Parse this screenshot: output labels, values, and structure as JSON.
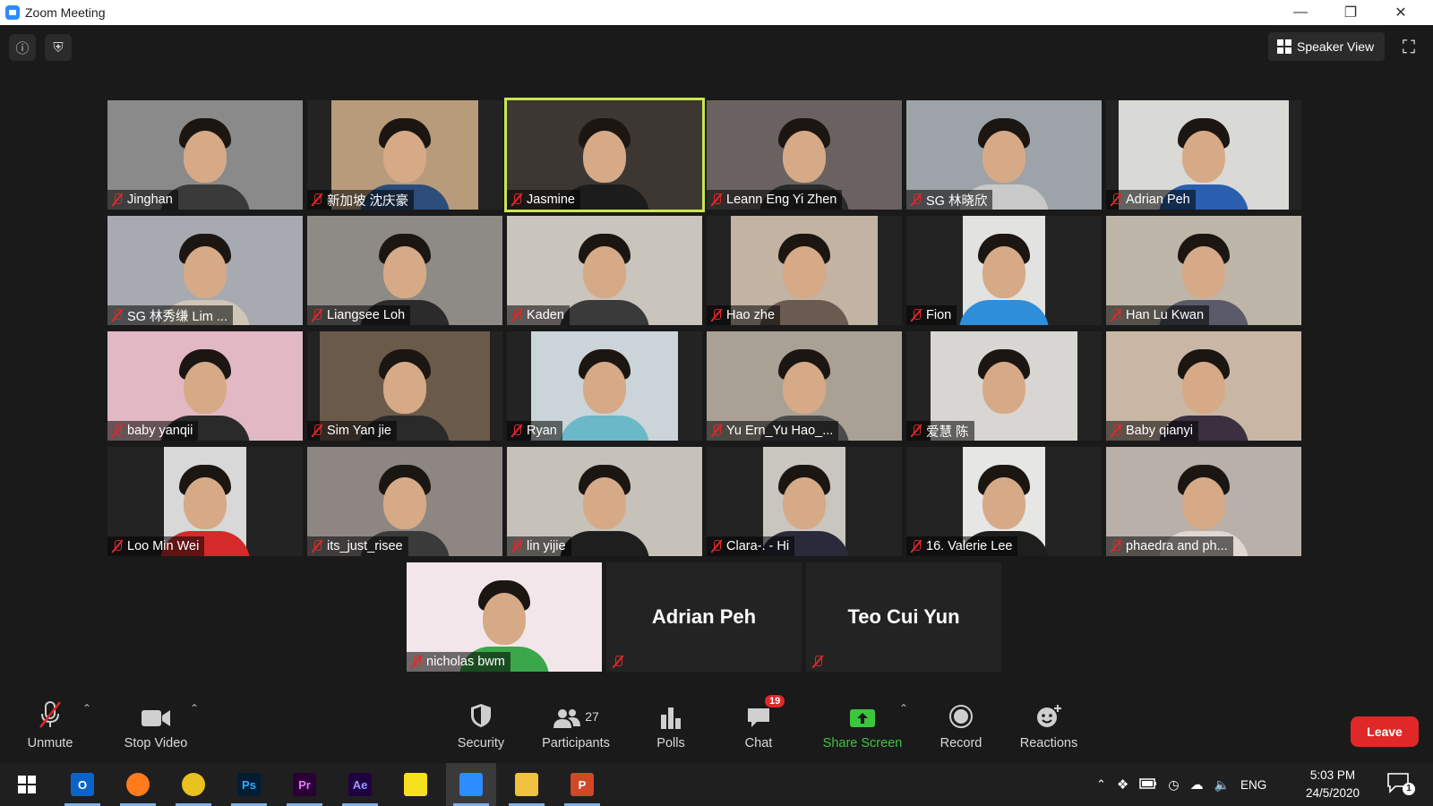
{
  "window": {
    "title": "Zoom Meeting"
  },
  "top": {
    "speaker_view_label": "Speaker View"
  },
  "participants": [
    {
      "name": "Jinghan",
      "bg": "#8a8a8a",
      "shirt": "#3a3a3a"
    },
    {
      "name": "新加坡 沈庆豪",
      "bg": "#b89b7a",
      "shirt": "#2d4d7a"
    },
    {
      "name": "Jasmine",
      "bg": "#3d3733",
      "shirt": "#1c1c1c"
    },
    {
      "name": "Leann Eng Yi Zhen",
      "bg": "#6a6260",
      "shirt": "#2a2a2a"
    },
    {
      "name": "SG 林晓欣",
      "bg": "#9da3a8",
      "shirt": "#c9c9c9"
    },
    {
      "name": "Adrian Peh",
      "bg": "#d9d9d6",
      "shirt": "#2a5fb0"
    },
    {
      "name": "SG 林秀缣 Lim ...",
      "bg": "#a7aab0",
      "shirt": "#cfc6b8"
    },
    {
      "name": "Liangsee Loh",
      "bg": "#8e8a86",
      "shirt": "#2b2b2b"
    },
    {
      "name": "Kaden",
      "bg": "#c9c4bc",
      "shirt": "#3a3a3a"
    },
    {
      "name": "Hao zhe",
      "bg": "#c2b3a2",
      "shirt": "#6a5a50"
    },
    {
      "name": "Fion",
      "bg": "#e2e2e0",
      "shirt": "#2f8ed9"
    },
    {
      "name": "Han Lu Kwan",
      "bg": "#bdb6a8",
      "shirt": "#5a5a6a"
    },
    {
      "name": "baby yanqii",
      "bg": "#e2b8c4",
      "shirt": "#2a2a2a"
    },
    {
      "name": "Sim Yan jie",
      "bg": "#6a5a4a",
      "shirt": "#2a2a2a"
    },
    {
      "name": "Ryan",
      "bg": "#cbd4d8",
      "shirt": "#6ab8c8"
    },
    {
      "name": "Yu Ern_Yu Hao_...",
      "bg": "#a9a294",
      "shirt": "#4a4a4a"
    },
    {
      "name": "爱慧 陈",
      "bg": "#d8d6d2",
      "shirt": "#d8d6d2"
    },
    {
      "name": "Baby qianyi",
      "bg": "#c9b7a5",
      "shirt": "#3a3040"
    },
    {
      "name": "Loo Min Wei",
      "bg": "#d8d8d8",
      "shirt": "#d42a2a"
    },
    {
      "name": "its_just_risee",
      "bg": "#8d8683",
      "shirt": "#3a3a3a"
    },
    {
      "name": "lin yijie",
      "bg": "#c6c2ba",
      "shirt": "#1e1e1e"
    },
    {
      "name": "Clara-. - Hi",
      "bg": "#c9c6c0",
      "shirt": "#2a2a3a"
    },
    {
      "name": "16. Valerie Lee",
      "bg": "#e6e6e4",
      "shirt": "#1e1e1e"
    },
    {
      "name": "phaedra and ph...",
      "bg": "#b9b0aa",
      "shirt": "#e0d8d0"
    }
  ],
  "bottom_row": [
    {
      "name": "nicholas bwm",
      "bg": "#f3e6ea",
      "shirt": "#3aa84a"
    },
    {
      "name": "Adrian Peh"
    },
    {
      "name": "Teo Cui Yun"
    }
  ],
  "toolbar": {
    "unmute": "Unmute",
    "stop_video": "Stop Video",
    "security": "Security",
    "participants": "Participants",
    "participants_count": "27",
    "polls": "Polls",
    "chat": "Chat",
    "chat_badge": "19",
    "share_screen": "Share Screen",
    "record": "Record",
    "reactions": "Reactions",
    "leave": "Leave"
  },
  "taskbar": {
    "apps": [
      {
        "name": "outlook-icon",
        "label": "O",
        "bg": "#0a64c8",
        "fg": "#ffffff"
      },
      {
        "name": "firefox-icon",
        "label": "",
        "bg": "#ff7b1c",
        "fg": "#ffffff"
      },
      {
        "name": "chrome-icon",
        "label": "",
        "bg": "#e8c21e",
        "fg": "#ffffff"
      },
      {
        "name": "photoshop-icon",
        "label": "Ps",
        "bg": "#001d34",
        "fg": "#31a8ff"
      },
      {
        "name": "premiere-icon",
        "label": "Pr",
        "bg": "#2a0034",
        "fg": "#ea77ff"
      },
      {
        "name": "after-effects-icon",
        "label": "Ae",
        "bg": "#1f0040",
        "fg": "#9999ff"
      },
      {
        "name": "sticky-notes-icon",
        "label": "",
        "bg": "#f7e01c",
        "fg": "#222222"
      },
      {
        "name": "zoom-icon",
        "label": "",
        "bg": "#2d8cff",
        "fg": "#ffffff"
      },
      {
        "name": "file-explorer-icon",
        "label": "",
        "bg": "#f0c040",
        "fg": "#ffffff"
      },
      {
        "name": "powerpoint-icon",
        "label": "P",
        "bg": "#d24726",
        "fg": "#ffffff"
      }
    ],
    "lang": "ENG",
    "time": "5:03 PM",
    "date": "24/5/2020",
    "notification_count": "1"
  }
}
